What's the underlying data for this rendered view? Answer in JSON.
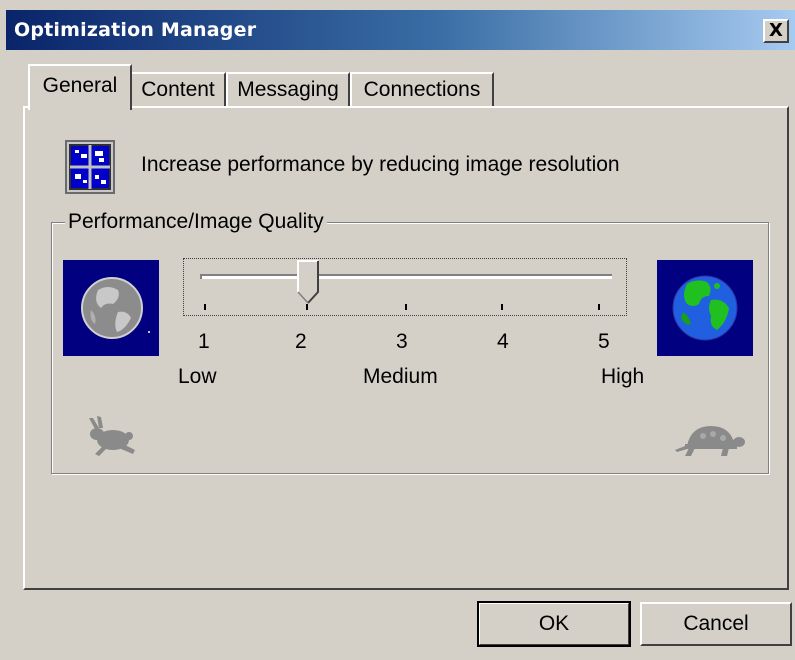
{
  "window": {
    "title": "Optimization Manager",
    "close_label": "X"
  },
  "tabs": [
    {
      "label": "General",
      "active": true
    },
    {
      "label": "Content",
      "active": false
    },
    {
      "label": "Messaging",
      "active": false
    },
    {
      "label": "Connections",
      "active": false
    }
  ],
  "general": {
    "description": "Increase performance by reducing image resolution",
    "group_label": "Performance/Image Quality",
    "slider": {
      "value": 2,
      "min": 1,
      "max": 5,
      "ticks": [
        "1",
        "2",
        "3",
        "4",
        "5"
      ],
      "range_labels": {
        "low": "Low",
        "medium": "Medium",
        "high": "High"
      }
    },
    "icons": {
      "left_globe": "low-resolution-globe-icon",
      "right_globe": "high-resolution-globe-icon",
      "left_animal": "rabbit-icon",
      "right_animal": "turtle-icon",
      "description_icon": "image-resolution-icon"
    }
  },
  "buttons": {
    "ok": "OK",
    "cancel": "Cancel"
  },
  "colors": {
    "titlebar_start": "#0a246a",
    "titlebar_end": "#a6caf0",
    "face": "#d4d0c8",
    "globe_bg": "#000080"
  }
}
